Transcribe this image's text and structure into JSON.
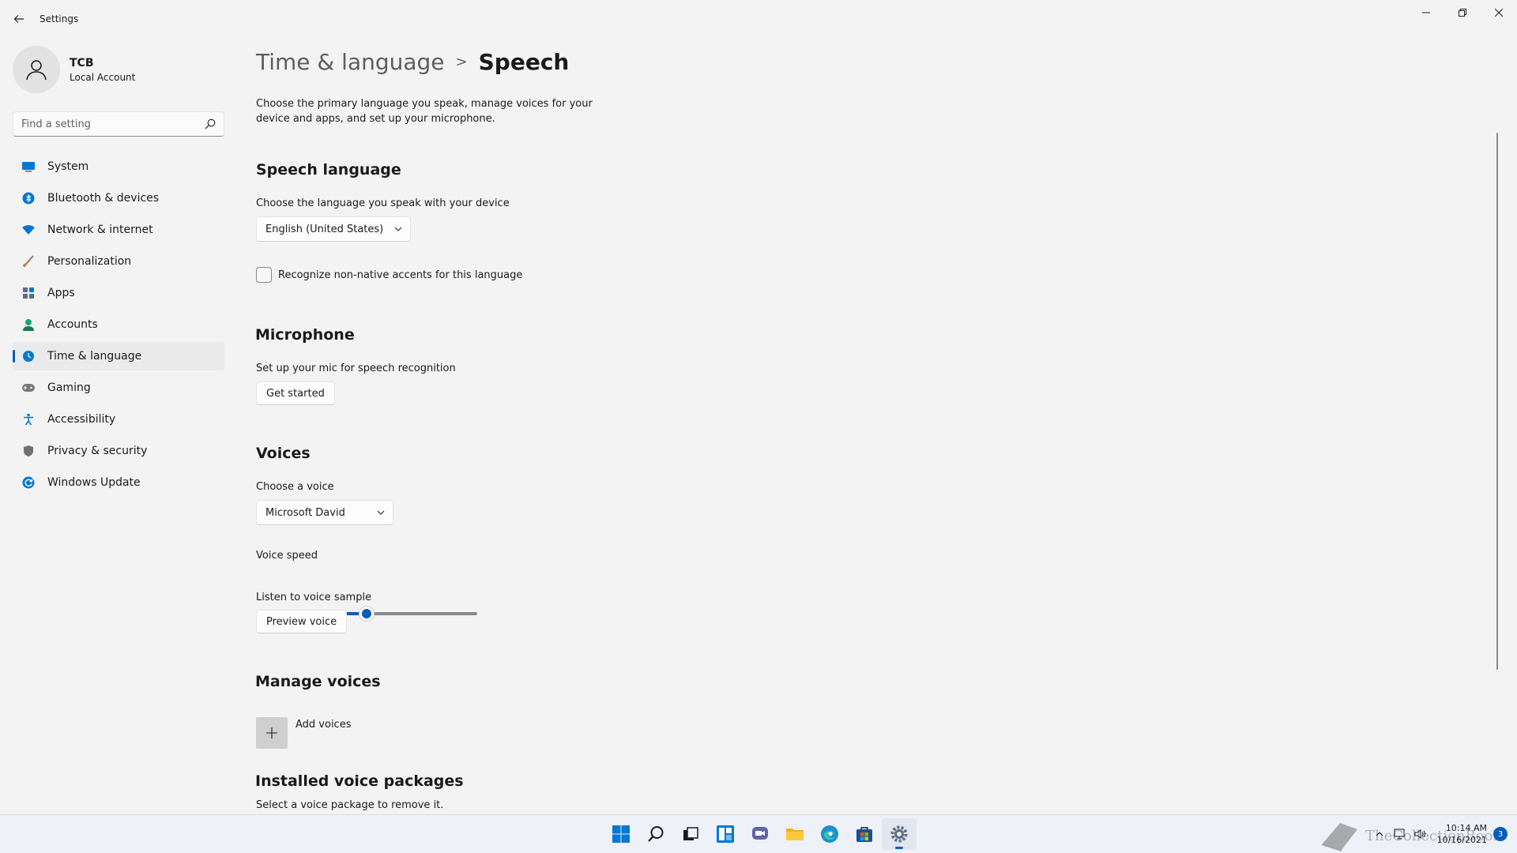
{
  "window": {
    "title": "Settings",
    "controls": [
      "minimize-icon",
      "restore-icon",
      "close-icon"
    ]
  },
  "profile": {
    "name": "TCB",
    "account_type": "Local Account"
  },
  "search": {
    "placeholder": "Find a setting"
  },
  "sidebar": {
    "items": [
      {
        "label": "System",
        "icon": "system-icon",
        "color": "#0078d4"
      },
      {
        "label": "Bluetooth & devices",
        "icon": "bluetooth-icon",
        "color": "#0078d4"
      },
      {
        "label": "Network & internet",
        "icon": "network-icon",
        "color": "#0078d4"
      },
      {
        "label": "Personalization",
        "icon": "brush-icon",
        "color": "#c47a37"
      },
      {
        "label": "Apps",
        "icon": "apps-icon",
        "color": "#5b6d89"
      },
      {
        "label": "Accounts",
        "icon": "accounts-icon",
        "color": "#1aa37a"
      },
      {
        "label": "Time & language",
        "icon": "globe-clock-icon",
        "color": "#0078d4",
        "active": true
      },
      {
        "label": "Gaming",
        "icon": "gaming-icon",
        "color": "#7a7a7a"
      },
      {
        "label": "Accessibility",
        "icon": "accessibility-icon",
        "color": "#0078d4"
      },
      {
        "label": "Privacy & security",
        "icon": "shield-icon",
        "color": "#707070"
      },
      {
        "label": "Windows Update",
        "icon": "update-icon",
        "color": "#0078d4"
      }
    ]
  },
  "breadcrumb": {
    "parent": "Time & language",
    "separator": ">",
    "current": "Speech"
  },
  "intro": "Choose the primary language you speak, manage voices for your device and apps, and set up your microphone.",
  "speech_language": {
    "title": "Speech language",
    "label": "Choose the language you speak with your device",
    "selected": "English (United States)",
    "checkbox_label": "Recognize non-native accents for this language",
    "checkbox_checked": false
  },
  "microphone": {
    "title": "Microphone",
    "label": "Set up your mic for speech recognition",
    "button": "Get started"
  },
  "voices": {
    "title": "Voices",
    "choose_label": "Choose a voice",
    "selected": "Microsoft David",
    "speed_label": "Voice speed",
    "speed_fraction": 0.5,
    "sample_label": "Listen to voice sample",
    "preview_button": "Preview voice"
  },
  "manage_voices": {
    "title": "Manage voices",
    "add_label": "Add voices"
  },
  "installed_packages": {
    "title": "Installed voice packages",
    "subtitle": "Select a voice package to remove it."
  },
  "taskbar": {
    "apps": [
      "start-icon",
      "search-icon",
      "task-view-icon",
      "widgets-icon",
      "chat-icon",
      "file-explorer-icon",
      "edge-icon",
      "store-icon",
      "settings-icon"
    ],
    "active_app": "settings-icon",
    "time": "10:14 AM",
    "date": "10/16/2021",
    "notification_count": "3",
    "watermark": "TheCollectionBook"
  },
  "colors": {
    "accent": "#005fb8",
    "background": "#f3f3f3"
  }
}
